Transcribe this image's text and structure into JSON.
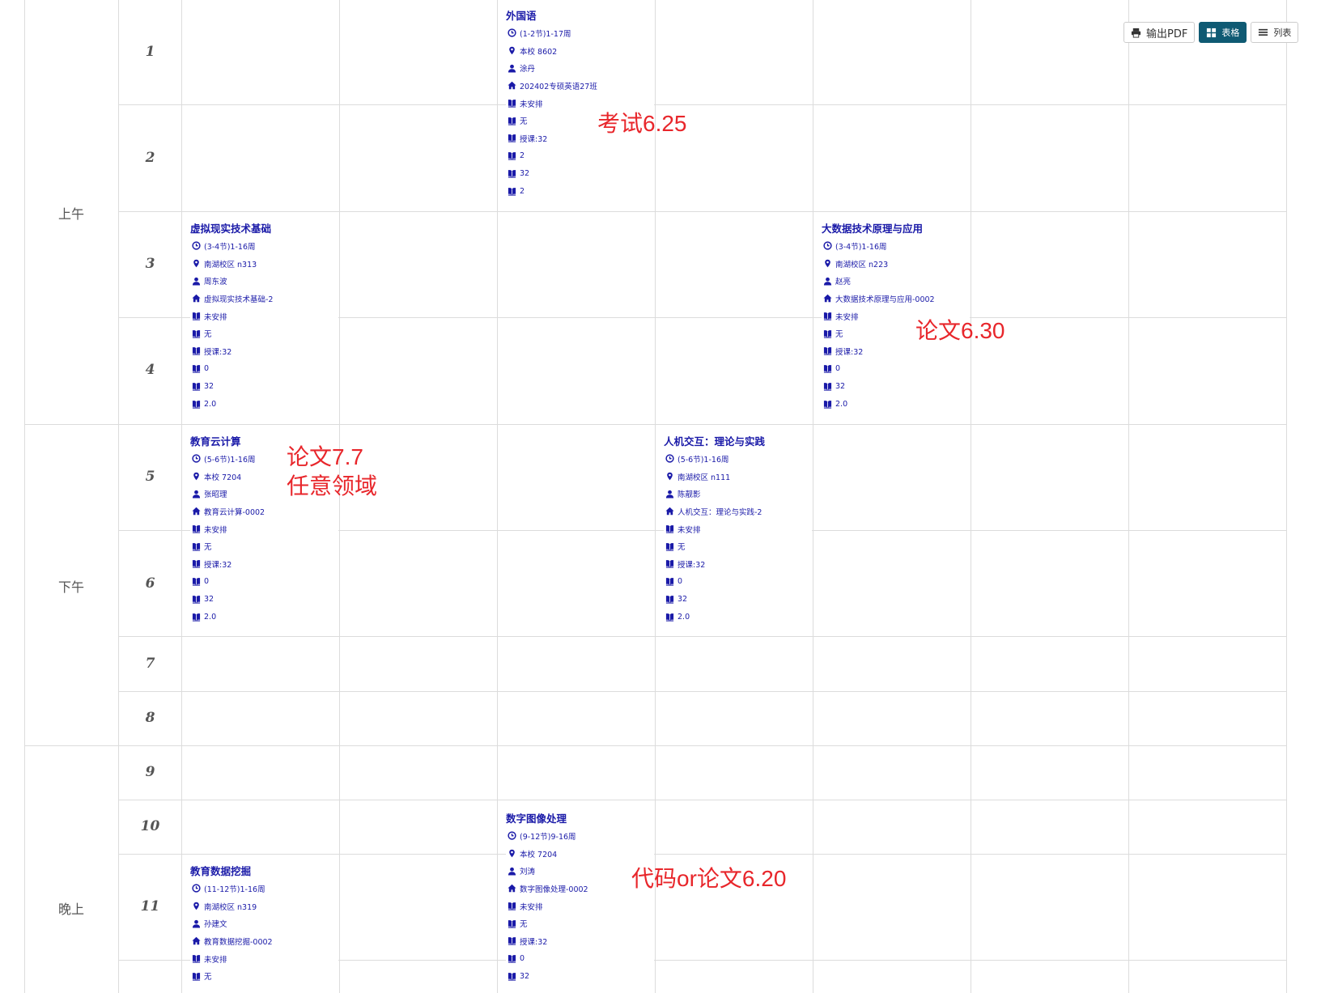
{
  "toolbar": {
    "pdf_label": "输出PDF",
    "table_label": "表格",
    "list_label": "列表"
  },
  "periods": {
    "morning": "上午",
    "afternoon": "下午",
    "evening": "晚上"
  },
  "sections": [
    "1",
    "2",
    "3",
    "4",
    "5",
    "6",
    "7",
    "8",
    "9",
    "10",
    "11"
  ],
  "courses": {
    "c1": {
      "title": "外国语",
      "time": "(1-2节)1-17周",
      "location": "本校 8602",
      "teacher": "涂丹",
      "class": "202402专硕英语27班",
      "arrangement": "未安排",
      "none": "无",
      "hours": "授课:32",
      "v1": "2",
      "v2": "32",
      "v3": "2"
    },
    "c2": {
      "title": "虚拟现实技术基础",
      "time": "(3-4节)1-16周",
      "location": "南湖校区 n313",
      "teacher": "周东波",
      "class": "虚拟现实技术基础-2",
      "arrangement": "未安排",
      "none": "无",
      "hours": "授课:32",
      "v1": "0",
      "v2": "32",
      "v3": "2.0"
    },
    "c3": {
      "title": "大数据技术原理与应用",
      "time": "(3-4节)1-16周",
      "location": "南湖校区 n223",
      "teacher": "赵亮",
      "class": "大数据技术原理与应用-0002",
      "arrangement": "未安排",
      "none": "无",
      "hours": "授课:32",
      "v1": "0",
      "v2": "32",
      "v3": "2.0"
    },
    "c4": {
      "title": "教育云计算",
      "time": "(5-6节)1-16周",
      "location": "本校 7204",
      "teacher": "张昭理",
      "class": "教育云计算-0002",
      "arrangement": "未安排",
      "none": "无",
      "hours": "授课:32",
      "v1": "0",
      "v2": "32",
      "v3": "2.0"
    },
    "c5": {
      "title": "人机交互：理论与实践",
      "time": "(5-6节)1-16周",
      "location": "南湖校区 n111",
      "teacher": "陈靓影",
      "class": "人机交互：理论与实践-2",
      "arrangement": "未安排",
      "none": "无",
      "hours": "授课:32",
      "v1": "0",
      "v2": "32",
      "v3": "2.0"
    },
    "c6": {
      "title": "数字图像处理",
      "time": "(9-12节)9-16周",
      "location": "本校 7204",
      "teacher": "刘涛",
      "class": "数字图像处理-0002",
      "arrangement": "未安排",
      "none": "无",
      "hours": "授课:32",
      "v1": "0",
      "v2": "32"
    },
    "c7": {
      "title": "教育数据挖掘",
      "time": "(11-12节)1-16周",
      "location": "南湖校区 n319",
      "teacher": "孙建文",
      "class": "教育数据挖掘-0002",
      "arrangement": "未安排",
      "none": "无"
    }
  },
  "notes": {
    "n1": "考试6.25",
    "n2": "论文6.30",
    "n3a": "论文7.7",
    "n3b": "任意领域",
    "n4": "代码or论文6.20"
  },
  "colors": {
    "course_text": "#1a1aa8",
    "note_red": "#e8262b",
    "grid_line": "#dcdcdc",
    "active_button": "#0f5a73"
  }
}
